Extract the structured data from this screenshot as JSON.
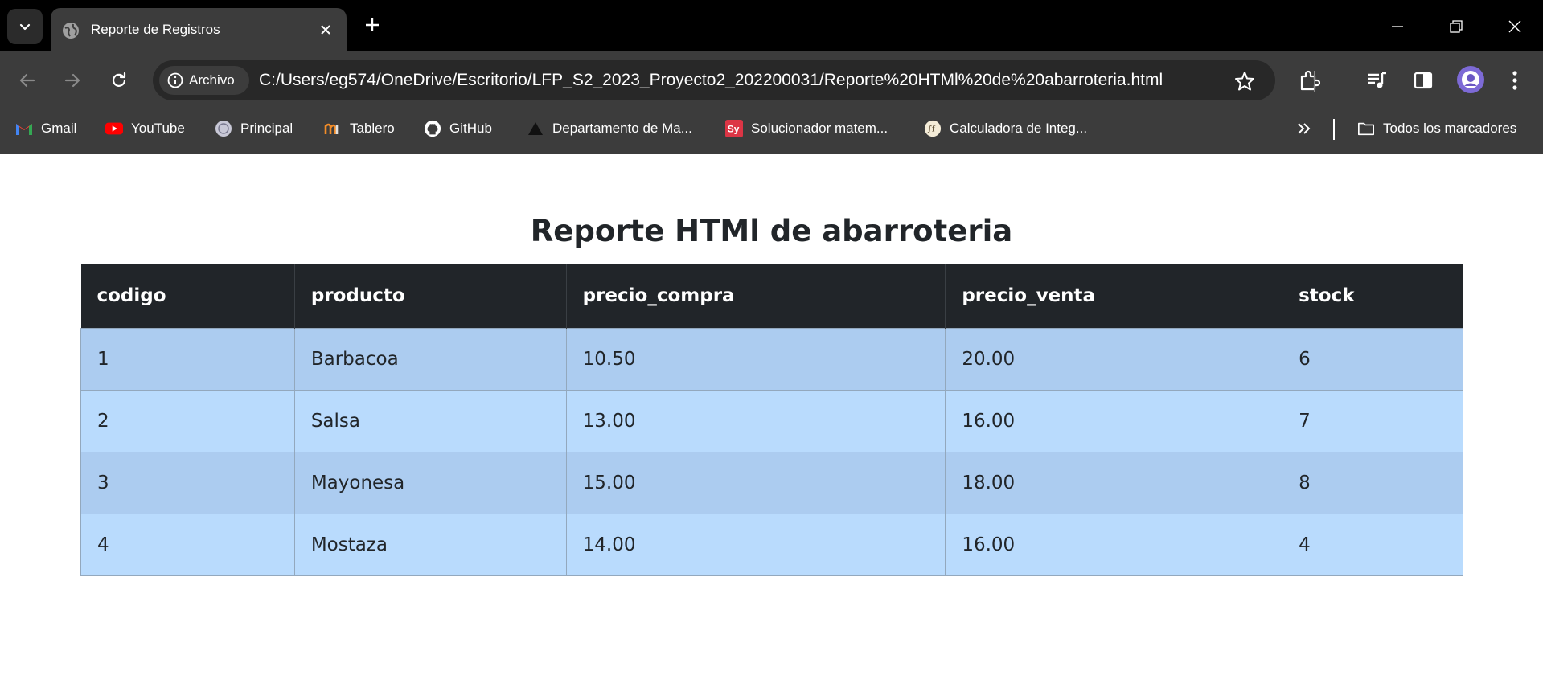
{
  "browser": {
    "tab_title": "Reporte de Registros",
    "site_chip": "Archivo",
    "url": "C:/Users/eg574/OneDrive/Escritorio/LFP_S2_2023_Proyecto2_202200031/Reporte%20HTMl%20de%20abarroteria.html"
  },
  "bookmarks": {
    "items": [
      {
        "label": "Gmail",
        "icon": "gmail-icon"
      },
      {
        "label": "YouTube",
        "icon": "youtube-icon"
      },
      {
        "label": "Principal",
        "icon": "principal-icon"
      },
      {
        "label": "Tablero",
        "icon": "tablero-icon"
      },
      {
        "label": "GitHub",
        "icon": "github-icon"
      },
      {
        "label": "Departamento de Ma...",
        "icon": "departamento-icon"
      },
      {
        "label": "Solucionador matem...",
        "icon": "symbolab-icon"
      },
      {
        "label": "Calculadora de Integ...",
        "icon": "calculadora-icon"
      }
    ],
    "all_bookmarks": "Todos los marcadores"
  },
  "report": {
    "title": "Reporte HTMl de abarroteria",
    "columns": [
      "codigo",
      "producto",
      "precio_compra",
      "precio_venta",
      "stock"
    ],
    "rows": [
      [
        "1",
        "Barbacoa",
        "10.50",
        "20.00",
        "6"
      ],
      [
        "2",
        "Salsa",
        "13.00",
        "16.00",
        "7"
      ],
      [
        "3",
        "Mayonesa",
        "15.00",
        "18.00",
        "8"
      ],
      [
        "4",
        "Mostaza",
        "14.00",
        "16.00",
        "4"
      ]
    ]
  },
  "colors": {
    "header_bg": "#212529",
    "row_odd": "#acccf0",
    "row_even": "#b9dbfd"
  }
}
